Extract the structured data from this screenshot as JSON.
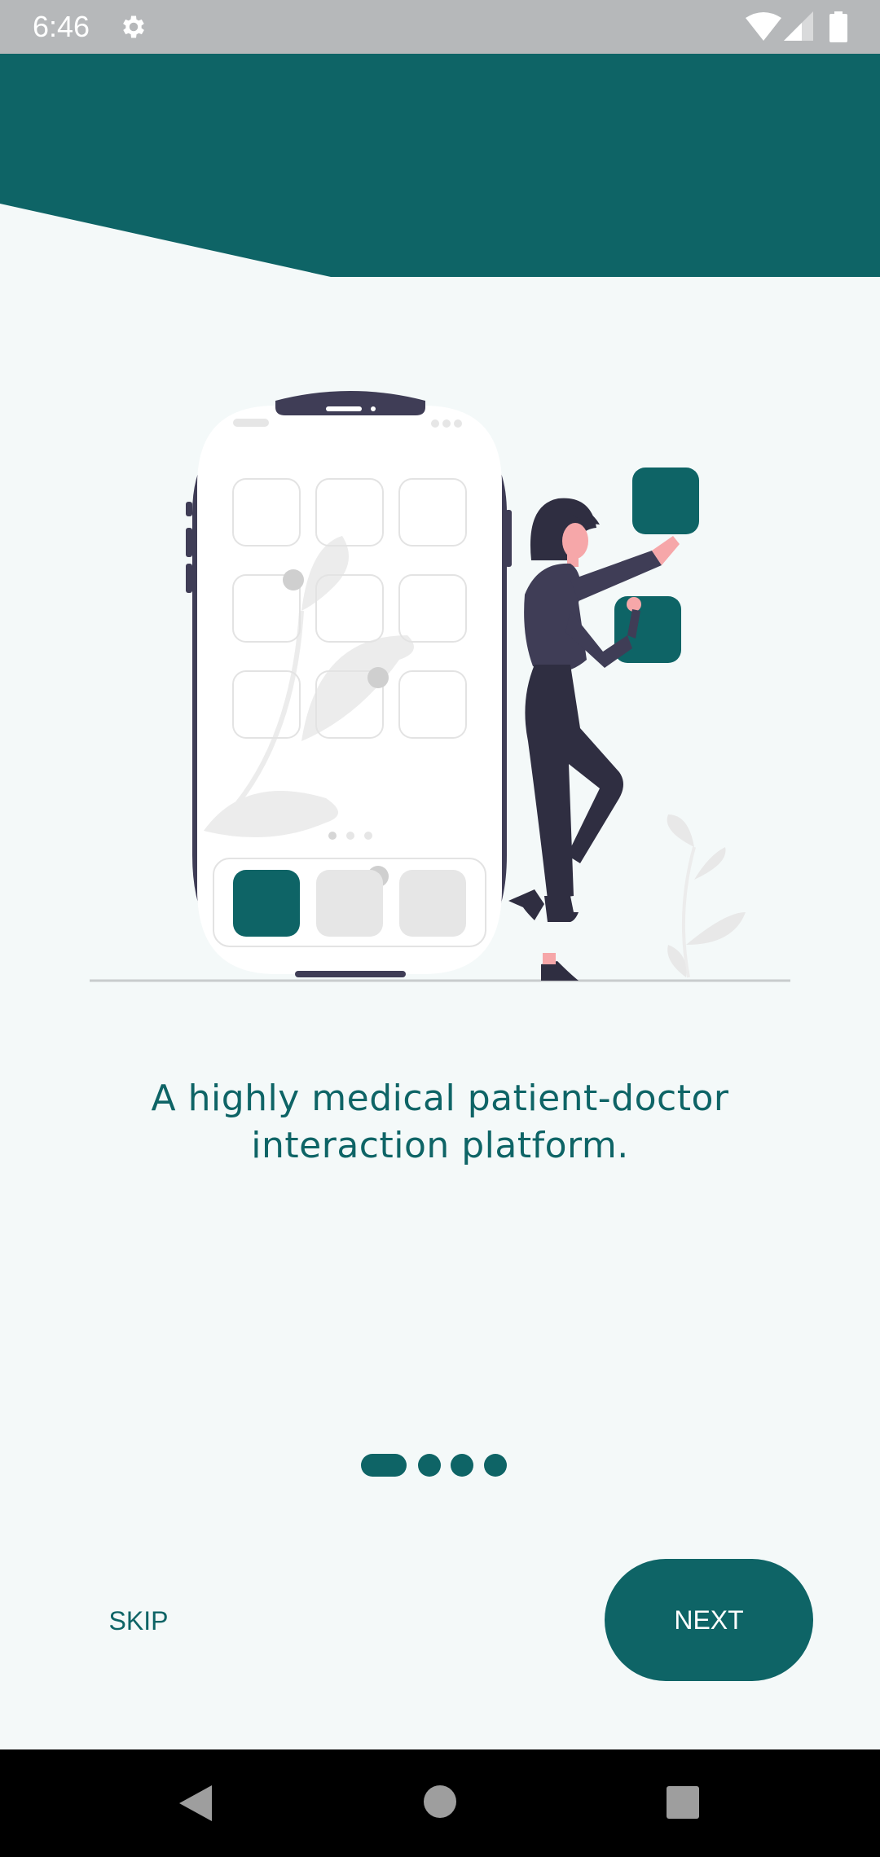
{
  "status_bar": {
    "time": "6:46",
    "icons": [
      "gear-icon",
      "wifi-icon",
      "cell-signal-icon",
      "battery-icon"
    ]
  },
  "onboarding": {
    "tagline": "A highly medical patient-doctor interaction platform.",
    "page_indicator": {
      "total": 4,
      "current": 1
    },
    "skip_label": "SKIP",
    "next_label": "NEXT"
  },
  "nav_bar": {
    "icons": [
      "back-icon",
      "home-icon",
      "recent-apps-icon"
    ]
  },
  "colors": {
    "primary": "#0e6466",
    "background": "#f4f9f9",
    "status_bar": "#b6b8ba",
    "nav_bar": "#000000",
    "figure_dark": "#3f3d56"
  }
}
